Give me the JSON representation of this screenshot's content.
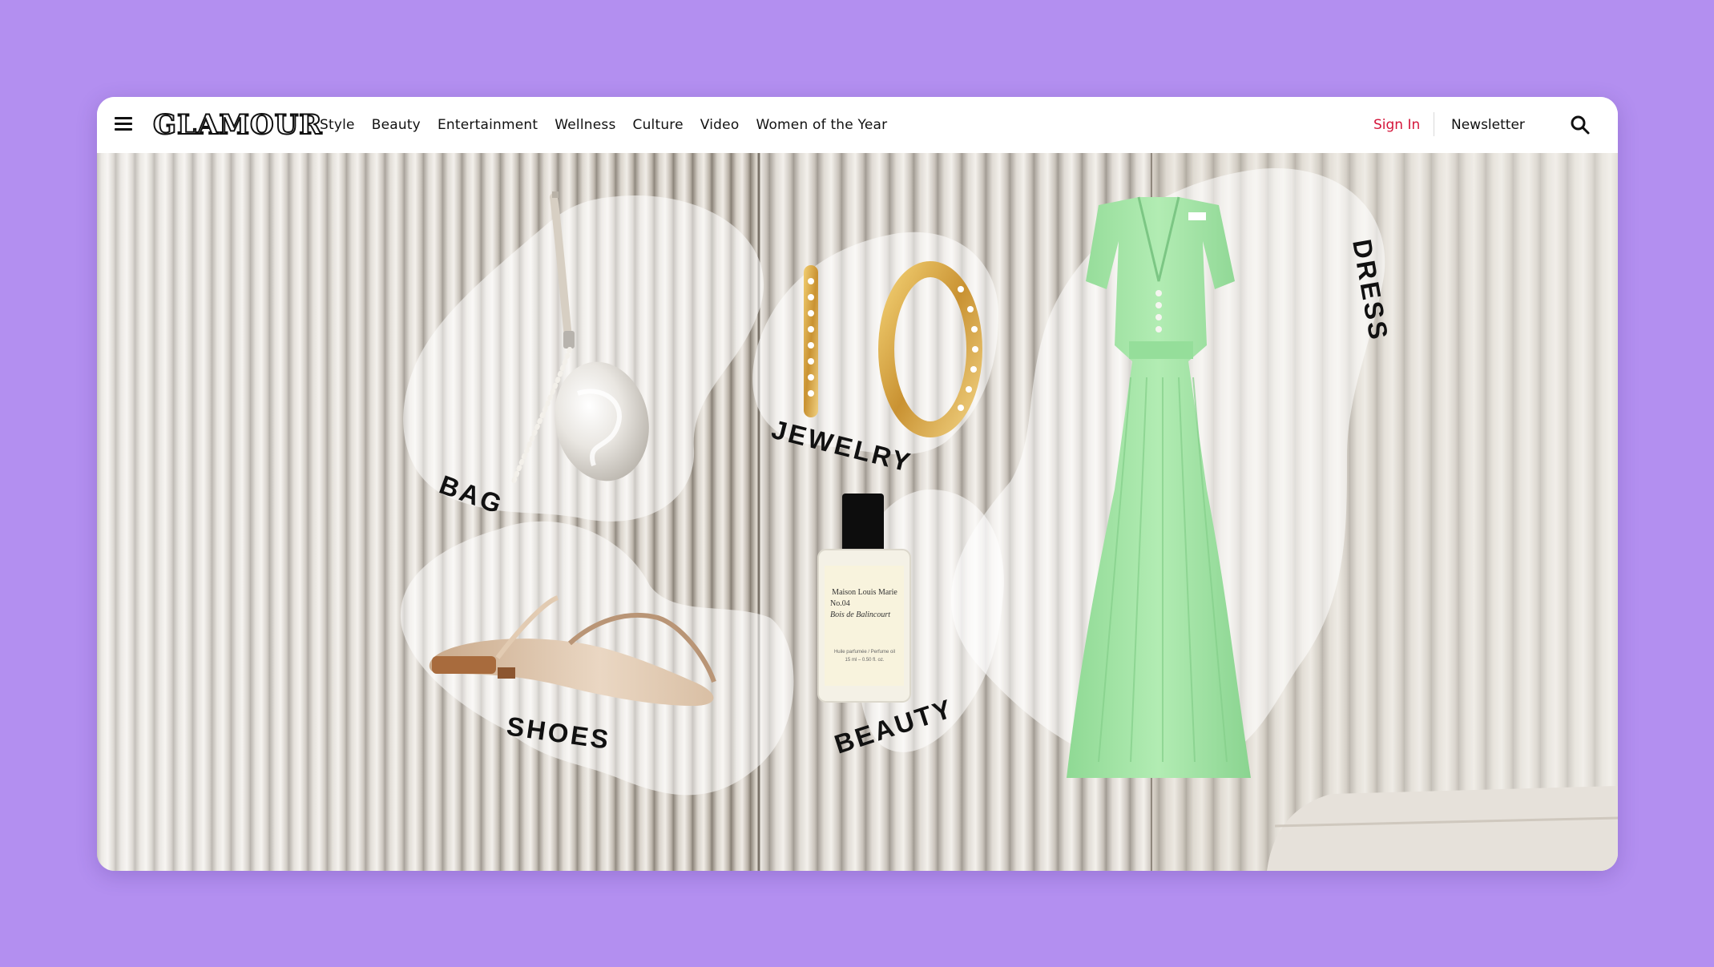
{
  "brand": {
    "name": "GLAMOUR"
  },
  "nav": {
    "links": [
      {
        "label": "Style"
      },
      {
        "label": "Beauty"
      },
      {
        "label": "Entertainment"
      },
      {
        "label": "Wellness"
      },
      {
        "label": "Culture"
      },
      {
        "label": "Video"
      },
      {
        "label": "Women of the Year"
      }
    ],
    "sign_in": "Sign In",
    "newsletter": "Newsletter",
    "menu_icon": "hamburger-menu-icon",
    "search_icon": "search-icon"
  },
  "hero": {
    "categories": {
      "bag": "BAG",
      "shoes": "SHOES",
      "jewelry": "JEWELRY",
      "beauty": "BEAUTY",
      "dress": "DRESS"
    },
    "perfume_label": {
      "line1": "Maison Louis Marie",
      "line2": "No.04",
      "line3": "Bois de Balincourt",
      "fine1": "Huile parfumée / Perfume oil",
      "fine2": "15 ml – 0.50 fl. oz."
    }
  },
  "colors": {
    "page_background": "#b38ff0",
    "sign_in": "#d4153a",
    "dress": "#a6e6a8",
    "gold": "#d9a845"
  }
}
